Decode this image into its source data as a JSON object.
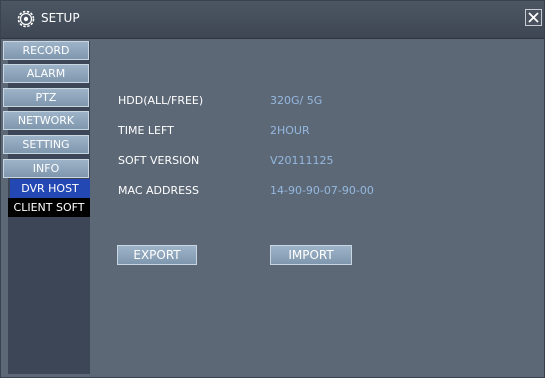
{
  "window": {
    "title": "SETUP"
  },
  "sidebar": {
    "items": [
      {
        "label": "RECORD"
      },
      {
        "label": "ALARM"
      },
      {
        "label": "PTZ"
      },
      {
        "label": "NETWORK"
      },
      {
        "label": "SETTING"
      },
      {
        "label": "INFO"
      },
      {
        "label": "DVR HOST"
      },
      {
        "label": "CLIENT SOFT"
      }
    ]
  },
  "info": {
    "rows": [
      {
        "label": "HDD(ALL/FREE)",
        "value": "320G/ 5G"
      },
      {
        "label": "TIME LEFT",
        "value": "2HOUR"
      },
      {
        "label": "SOFT VERSION",
        "value": "V20111125"
      },
      {
        "label": "MAC ADDRESS",
        "value": "14-90-90-07-90-00"
      }
    ]
  },
  "buttons": {
    "export": "EXPORT",
    "import": "IMPORT"
  },
  "icons": {
    "title": "gear-icon",
    "close": "close-icon"
  },
  "colors": {
    "background": "#5d6877",
    "active": "#2348b4",
    "value_text": "#94b8df"
  }
}
